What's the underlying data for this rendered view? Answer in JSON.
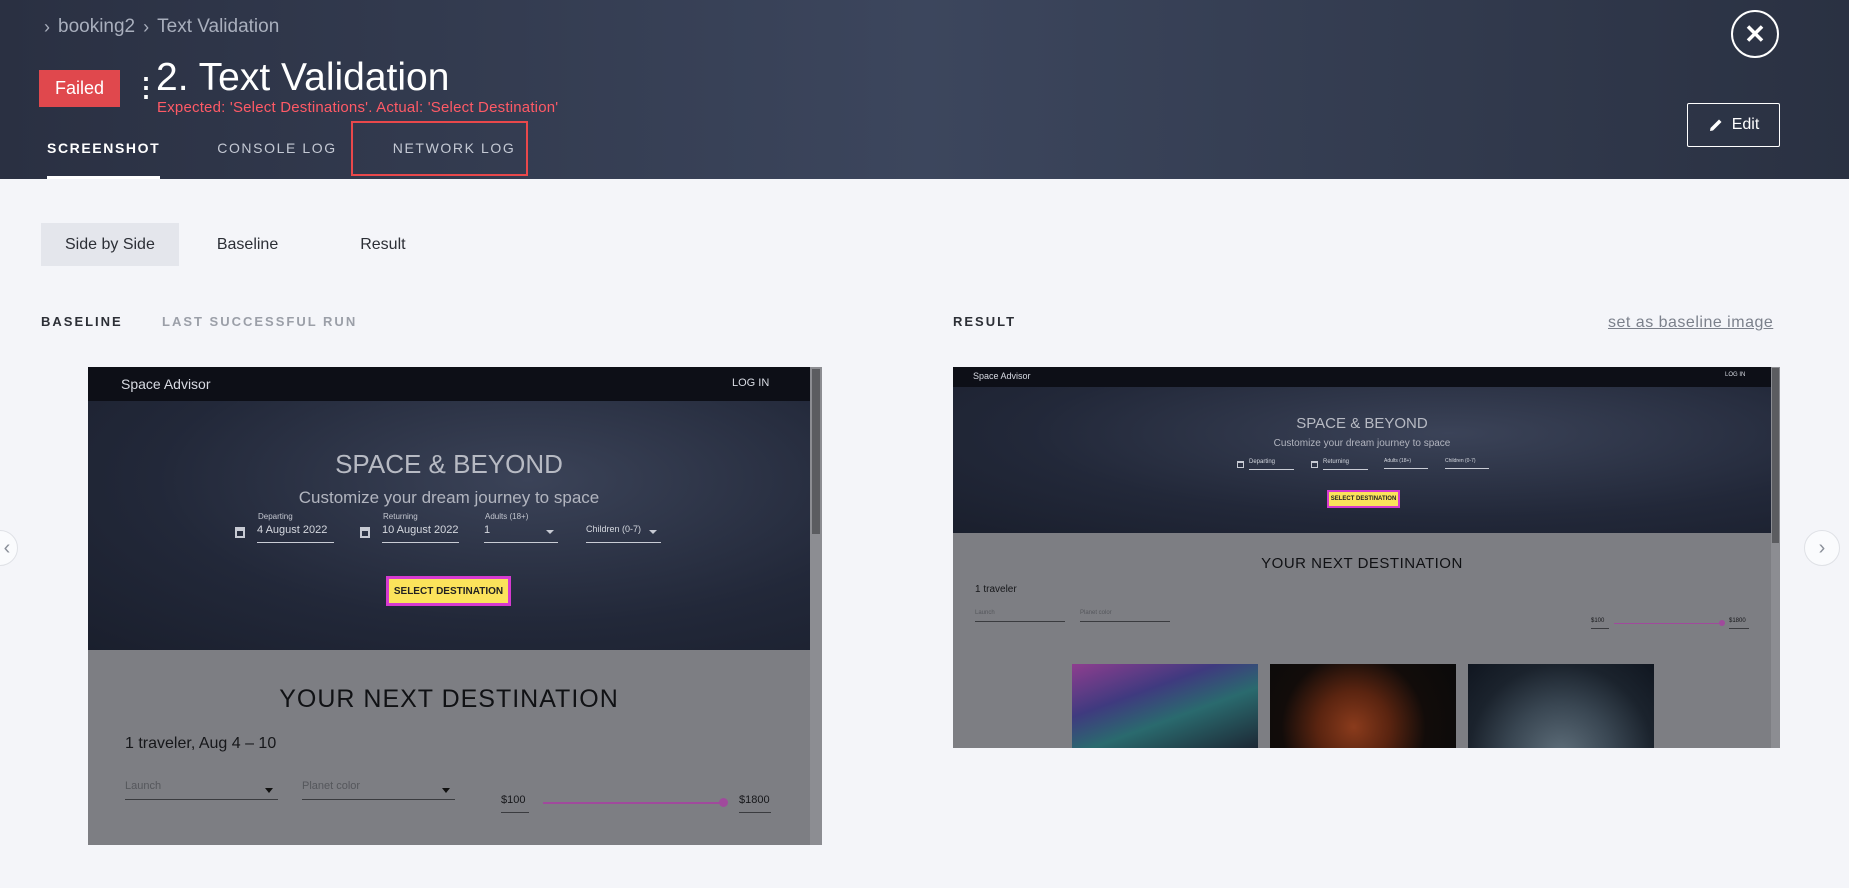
{
  "header": {
    "breadcrumbs": [
      "booking2",
      "Text Validation"
    ],
    "status": "Failed",
    "more": "⋮",
    "title": "2. Text Validation",
    "error": "Expected: 'Select Destinations'. Actual: 'Select Destination'",
    "tabs": [
      "SCREENSHOT",
      "CONSOLE LOG",
      "NETWORK LOG"
    ],
    "close_symbol": "✕",
    "edit_label": "Edit"
  },
  "view_tabs": [
    "Side by Side",
    "Baseline",
    "Result"
  ],
  "baseline_panel": {
    "label": "BASELINE",
    "sublabel": "LAST SUCCESSFUL RUN"
  },
  "result_panel": {
    "label": "RESULT",
    "set_baseline": "set as baseline image"
  },
  "baseline_shot": {
    "brand": "Space Advisor",
    "login": "LOG IN",
    "hero_title": "SPACE & BEYOND",
    "hero_sub": "Customize your dream journey to space",
    "departing_label": "Departing",
    "departing_value": "4 August 2022",
    "returning_label": "Returning",
    "returning_value": "10 August 2022",
    "adults_label": "Adults (18+)",
    "adults_value": "1",
    "children_label": "Children (0-7)",
    "button": "SELECT DESTINATION",
    "section_title": "YOUR NEXT DESTINATION",
    "travelers": "1 traveler, Aug 4 – 10",
    "launch": "Launch",
    "planet_color": "Planet color",
    "price_min": "$100",
    "price_max": "$1800"
  },
  "result_shot": {
    "brand": "Space Advisor",
    "login": "LOG IN",
    "hero_title": "SPACE & BEYOND",
    "hero_sub": "Customize your dream journey to space",
    "departing": "Departing",
    "returning": "Returning",
    "adults": "Adults (18+)",
    "children": "Children (0-7)",
    "button": "SELECT DESTINATION",
    "section_title": "YOUR NEXT DESTINATION",
    "travelers": "1 traveler",
    "launch": "Launch",
    "planet_color": "Planet color",
    "price_min": "$100",
    "price_max": "$1800"
  },
  "icons": {
    "breadcrumb_chevron": "chevron-right-icon",
    "close": "close-icon",
    "edit": "pencil-icon",
    "calendar": "calendar-icon",
    "prev": "chevron-left-icon",
    "next": "chevron-right-icon"
  },
  "colors": {
    "failed": "#e0484d",
    "error_text": "#ff5a66",
    "highlight_border": "#d63ad0",
    "highlight_fill": "#fbe35b",
    "tab_highlight_box": "#e9484b"
  }
}
